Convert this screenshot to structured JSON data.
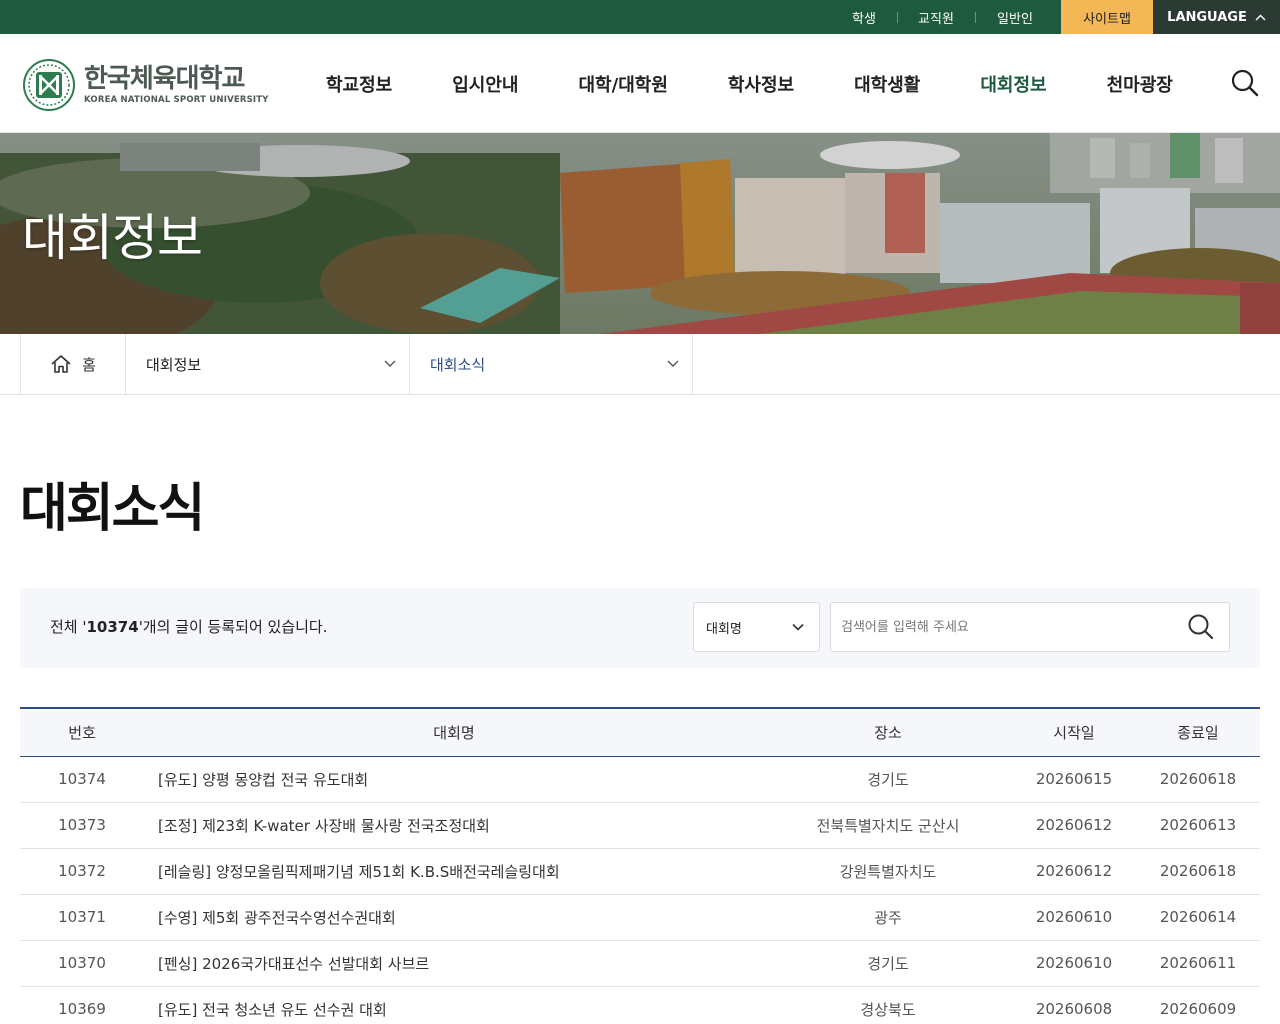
{
  "util": {
    "links": [
      "학생",
      "교직원",
      "일반인"
    ],
    "sitemap": "사이트맵",
    "language": "LANGUAGE"
  },
  "logo": {
    "kr": "한국체육대학교",
    "en": "KOREA NATIONAL SPORT UNIVERSITY"
  },
  "gnb": [
    "학교정보",
    "입시안내",
    "대학/대학원",
    "학사정보",
    "대학생활",
    "대회정보",
    "천마광장"
  ],
  "hero": {
    "title": "대회정보"
  },
  "breadcrumb": {
    "home": "홈",
    "level1": "대회정보",
    "level2": "대회소식"
  },
  "page": {
    "title": "대회소식"
  },
  "search": {
    "total_prefix": "전체 '",
    "total_count": "10374",
    "total_suffix": "'개의 글이 등록되어 있습니다.",
    "field": "대회명",
    "placeholder": "검색어를 입력해 주세요"
  },
  "table": {
    "headers": [
      "번호",
      "대회명",
      "장소",
      "시작일",
      "종료일"
    ],
    "rows": [
      [
        "10374",
        "[유도] 양평 몽양컵 전국 유도대회",
        "경기도",
        "20260615",
        "20260618"
      ],
      [
        "10373",
        "[조정] 제23회 K-water 사장배 물사랑 전국조정대회",
        "전북특별자치도 군산시",
        "20260612",
        "20260613"
      ],
      [
        "10372",
        "[레슬링] 양정모올림픽제패기념 제51회 K.B.S배전국레슬링대회",
        "강원특별자치도",
        "20260612",
        "20260618"
      ],
      [
        "10371",
        "[수영] 제5회 광주전국수영선수권대회",
        "광주",
        "20260610",
        "20260614"
      ],
      [
        "10370",
        "[펜싱] 2026국가대표선수 선발대회 사브르",
        "경기도",
        "20260610",
        "20260611"
      ],
      [
        "10369",
        "[유도] 전국 청소년 유도 선수권 대회",
        "경상북도",
        "20260608",
        "20260609"
      ]
    ]
  },
  "colors": {
    "brand_green": "#1e5b3e",
    "sitemap_yellow": "#f3b755",
    "table_navy": "#2a4f82",
    "breadcrumb_active": "#2f4e8a"
  }
}
